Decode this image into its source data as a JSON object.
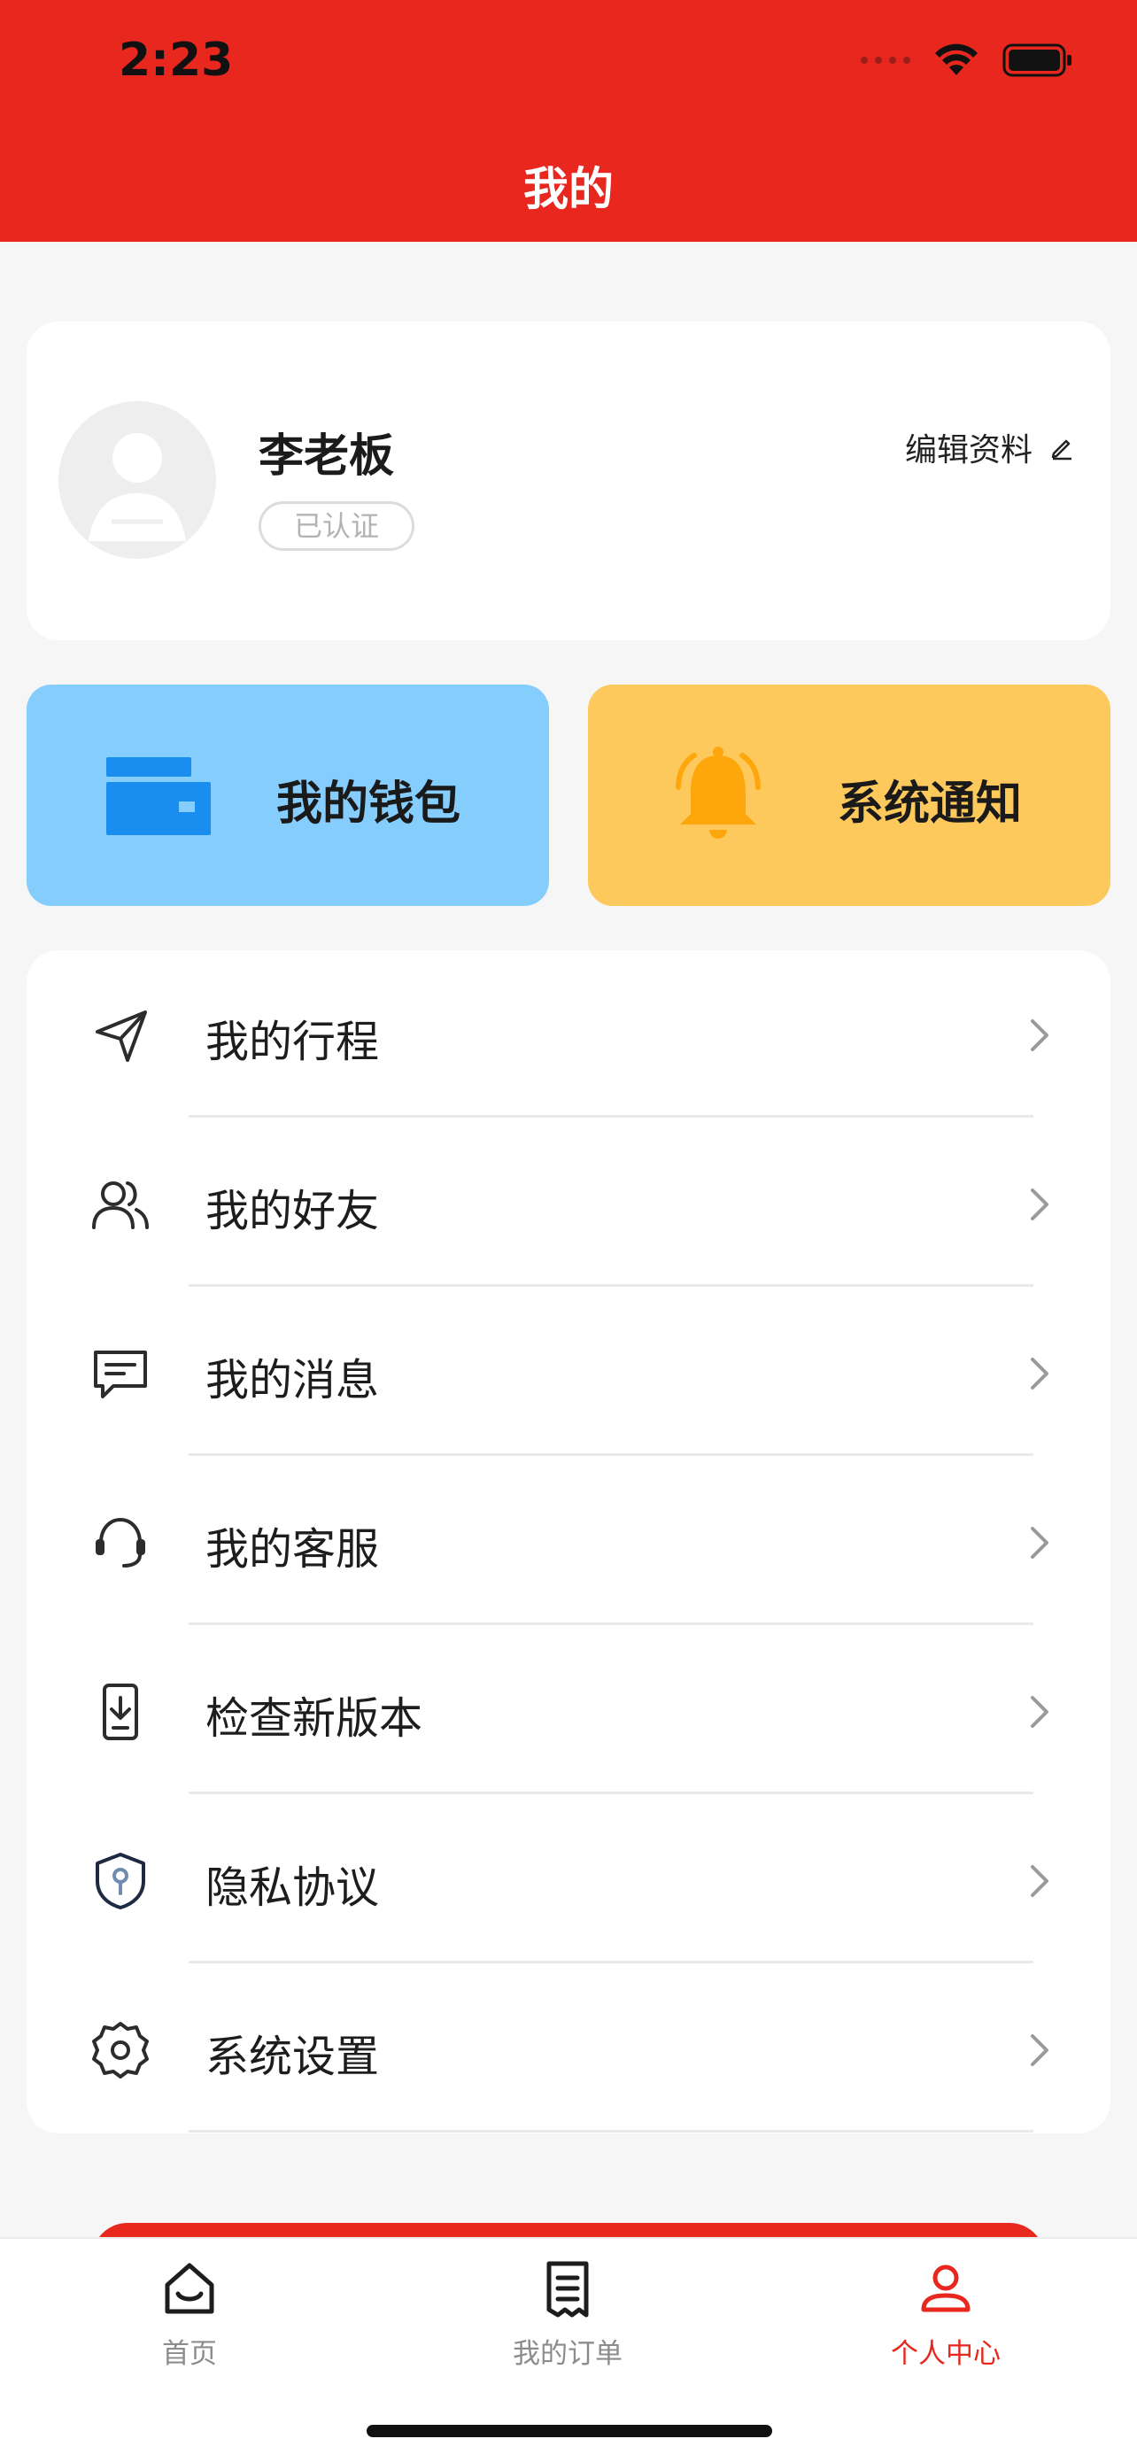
{
  "status_bar": {
    "time": "2:23"
  },
  "header": {
    "title": "我的"
  },
  "profile": {
    "name": "李老板",
    "verified_badge": "已认证",
    "edit_label": "编辑资料"
  },
  "actions": [
    {
      "label": "我的钱包",
      "icon": "wallet-icon",
      "color": "#84cdfd"
    },
    {
      "label": "系统通知",
      "icon": "bell-icon",
      "color": "#fec95c"
    }
  ],
  "menu": [
    {
      "label": "我的行程",
      "icon": "navigation-icon"
    },
    {
      "label": "我的好友",
      "icon": "friends-icon"
    },
    {
      "label": "我的消息",
      "icon": "message-icon"
    },
    {
      "label": "我的客服",
      "icon": "headset-icon"
    },
    {
      "label": "检查新版本",
      "icon": "download-icon"
    },
    {
      "label": "隐私协议",
      "icon": "shield-icon"
    },
    {
      "label": "系统设置",
      "icon": "gear-icon"
    }
  ],
  "tabbar": [
    {
      "label": "首页",
      "icon": "home-icon",
      "active": false
    },
    {
      "label": "我的订单",
      "icon": "receipt-icon",
      "active": false
    },
    {
      "label": "个人中心",
      "icon": "person-icon",
      "active": true
    }
  ],
  "colors": {
    "brand": "#e8271f",
    "wallet": "#84cdfd",
    "notice": "#fec95c"
  }
}
